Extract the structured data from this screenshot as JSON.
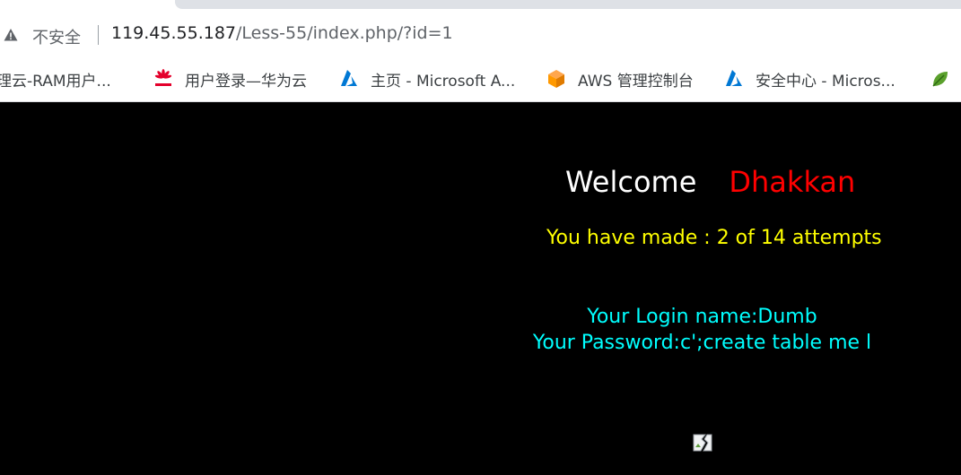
{
  "address_bar": {
    "security_label": "不安全",
    "url_host": "119.45.55.187",
    "url_path": "/Less-55/index.php/?id=1"
  },
  "bookmarks": [
    {
      "label": "理云-RAM用户...",
      "icon": "generic-bookmark-icon"
    },
    {
      "label": "用户登录—华为云",
      "icon": "huawei-icon"
    },
    {
      "label": "主页 - Microsoft A...",
      "icon": "azure-icon"
    },
    {
      "label": "AWS 管理控制台",
      "icon": "aws-icon"
    },
    {
      "label": "安全中心 - Micros...",
      "icon": "azure-icon"
    },
    {
      "label": "",
      "icon": "green-leaf-icon"
    }
  ],
  "page": {
    "welcome_word": "Welcome",
    "welcome_name": "Dhakkan",
    "attempts_text": "You have made : 2 of 14 attempts",
    "login_name_text": "Your Login name:Dumb",
    "password_text": "Your Password:c';create table me l"
  },
  "colors": {
    "page_background": "#000000",
    "welcome_name": "#ff0000",
    "attempts": "#ffff00",
    "login_info": "#00ffff"
  }
}
